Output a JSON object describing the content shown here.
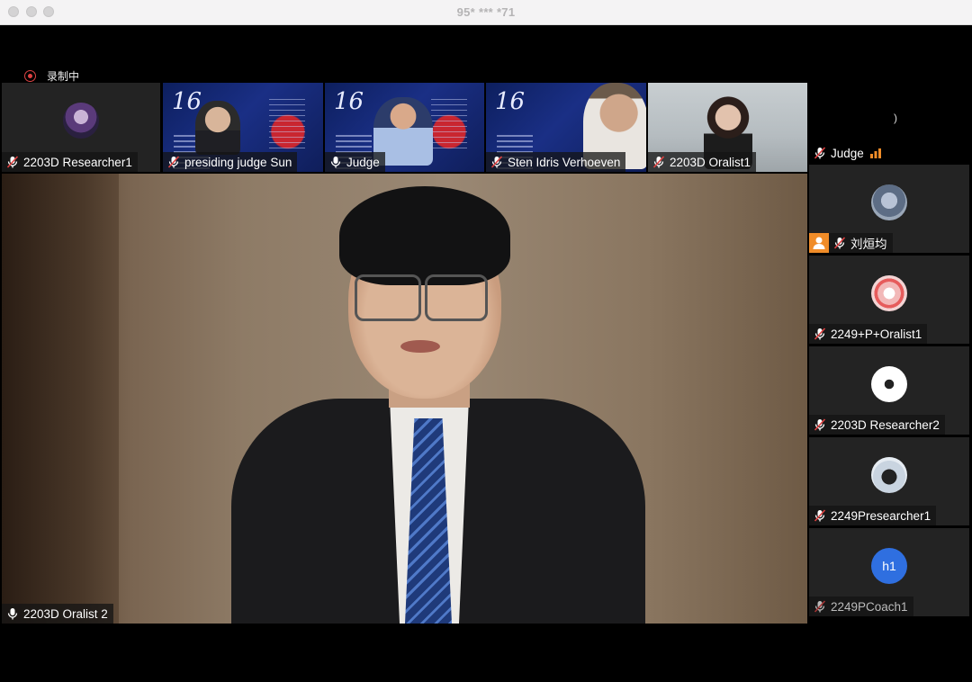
{
  "window": {
    "title": "95* *** *71"
  },
  "recording": {
    "label": "录制中"
  },
  "top_strip": [
    {
      "name": "2203D Researcher1",
      "muted": true
    },
    {
      "name": "presiding judge Sun",
      "muted": true
    },
    {
      "name": "Judge",
      "muted": false
    },
    {
      "name": "Sten Idris Verhoeven",
      "muted": true
    },
    {
      "name": "2203D Oralist1",
      "muted": true
    }
  ],
  "slide": {
    "logo": "16"
  },
  "main_speaker": {
    "name": "2203D Oralist 2",
    "muted": false
  },
  "sidebar": {
    "top_tile": {
      "name": "Judge",
      "partial_text": ")"
    },
    "tiles": [
      {
        "name": "刘烜均",
        "muted": true,
        "host_badge": true
      },
      {
        "name": "2249+P+Oralist1",
        "muted": true
      },
      {
        "name": "2203D Researcher2",
        "muted": true
      },
      {
        "name": "2249Presearcher1",
        "muted": true
      },
      {
        "name": "2249PCoach1",
        "muted": true,
        "initials": "h1"
      }
    ]
  },
  "colors": {
    "titlebar": "#f4f3f4",
    "tile_bg": "#232323",
    "recording_red": "#e04040",
    "audio_orange": "#f08c28",
    "initials_blue": "#2f6fe0",
    "host_badge": "#f08c28"
  }
}
